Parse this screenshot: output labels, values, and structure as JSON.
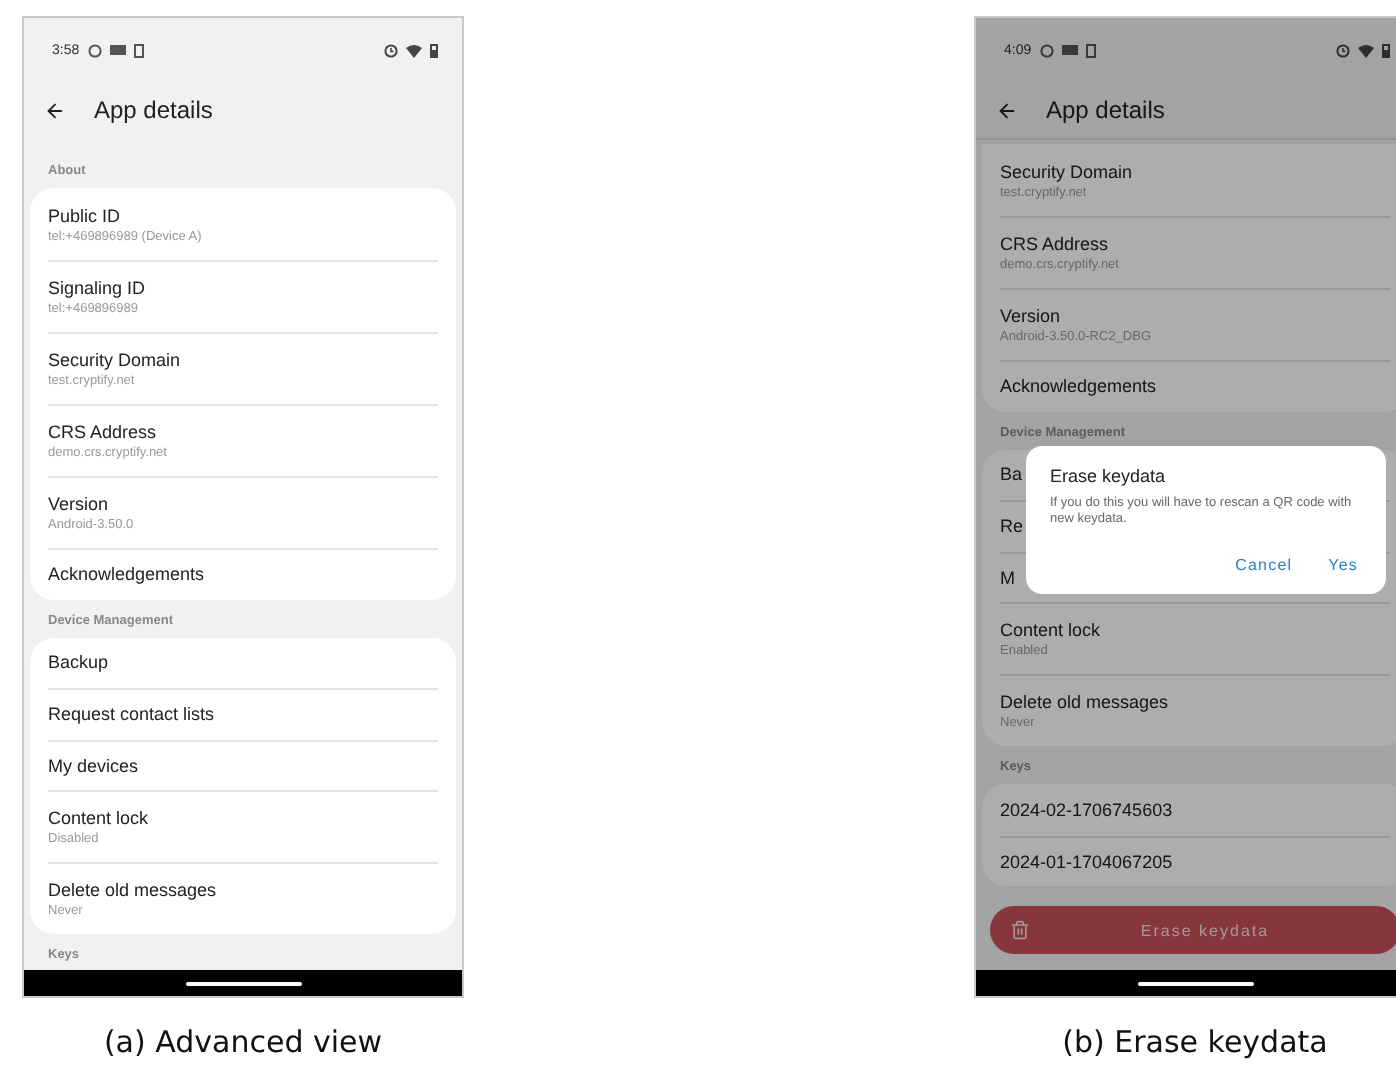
{
  "figures": [
    {
      "caption": "(a) Advanced view",
      "status_time": "3:58",
      "title": "App details",
      "dimmed": false,
      "sections": [
        {
          "label": "About",
          "items": [
            {
              "title": "Public ID",
              "subtitle": "tel:+469896989 (Device A)"
            },
            {
              "title": "Signaling ID",
              "subtitle": "tel:+469896989"
            },
            {
              "title": "Security Domain",
              "subtitle": "test.cryptify.net"
            },
            {
              "title": "CRS Address",
              "subtitle": "demo.crs.cryptify.net"
            },
            {
              "title": "Version",
              "subtitle": "Android-3.50.0"
            },
            {
              "title": "Acknowledgements"
            }
          ]
        },
        {
          "label": "Device Management",
          "items": [
            {
              "title": "Backup"
            },
            {
              "title": "Request contact lists"
            },
            {
              "title": "My devices"
            },
            {
              "title": "Content lock",
              "subtitle": "Disabled"
            },
            {
              "title": "Delete old messages",
              "subtitle": "Never"
            }
          ]
        },
        {
          "label": "Keys"
        }
      ]
    },
    {
      "caption": "(b) Erase keydata",
      "status_time": "4:09",
      "title": "App details",
      "dimmed": true,
      "sections": [
        {
          "items": [
            {
              "title": "Security Domain",
              "subtitle": "test.cryptify.net"
            },
            {
              "title": "CRS Address",
              "subtitle": "demo.crs.cryptify.net"
            },
            {
              "title": "Version",
              "subtitle": "Android-3.50.0-RC2_DBG"
            },
            {
              "title": "Acknowledgements"
            }
          ]
        },
        {
          "label": "Device Management",
          "items": [
            {
              "title": "Ba"
            },
            {
              "title": "Re"
            },
            {
              "title": "M"
            },
            {
              "title": "Content lock",
              "subtitle": "Enabled"
            },
            {
              "title": "Delete old messages",
              "subtitle": "Never"
            }
          ]
        },
        {
          "label": "Keys",
          "items": [
            {
              "title": "2024-02-1706745603"
            },
            {
              "title": "2024-01-1704067205"
            }
          ]
        }
      ],
      "action_button": {
        "label": "Erase keydata"
      },
      "dialog": {
        "title": "Erase keydata",
        "message": "If you do this you will have to rescan a QR code with new keydata.",
        "buttons": [
          "Cancel",
          "Yes"
        ]
      }
    }
  ]
}
